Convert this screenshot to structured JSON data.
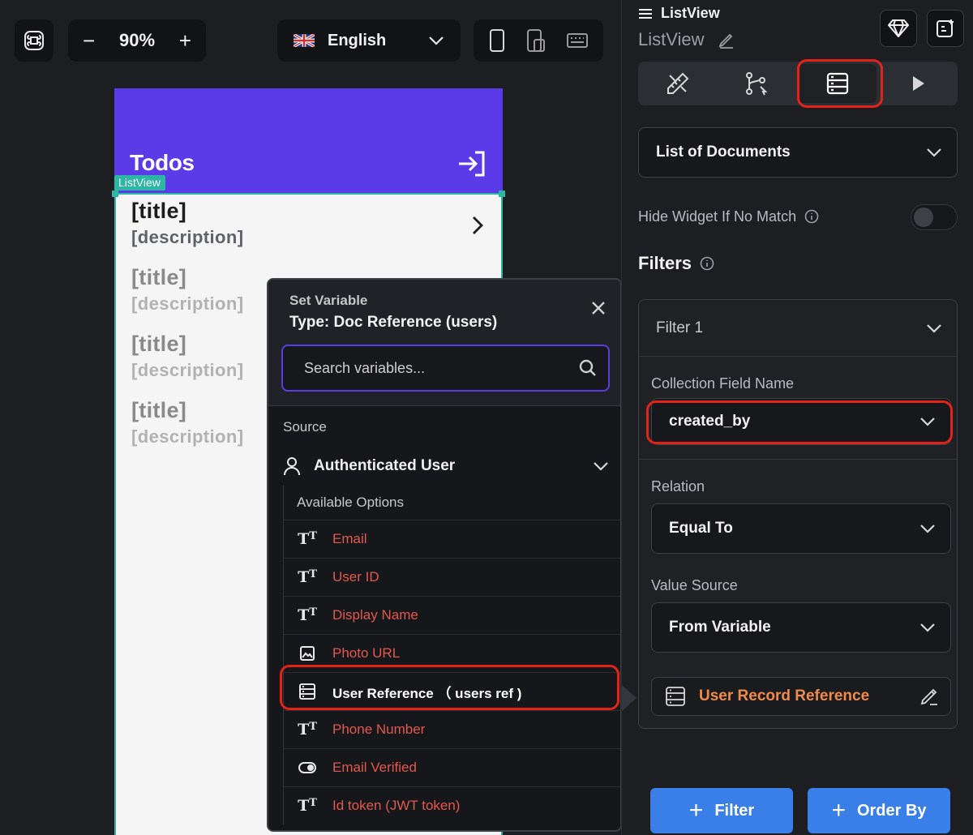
{
  "canvas": {
    "zoom": "90%",
    "zoom_minus": "−",
    "zoom_plus": "+",
    "language": "English",
    "phone": {
      "app_title": "Todos",
      "listview_tag": "ListView",
      "items": [
        {
          "title": "[title]",
          "description": "[description]"
        },
        {
          "title": "[title]",
          "description": "[description]"
        },
        {
          "title": "[title]",
          "description": "[description]"
        },
        {
          "title": "[title]",
          "description": "[description]"
        }
      ]
    }
  },
  "popup": {
    "subtitle": "Set Variable",
    "type": "Type: Doc Reference (users)",
    "search_placeholder": "Search variables...",
    "source_label": "Source",
    "source_value": "Authenticated User",
    "available_label": "Available Options",
    "options": [
      {
        "label": "Email",
        "icon": "text-type-icon"
      },
      {
        "label": "User ID",
        "icon": "text-type-icon"
      },
      {
        "label": "Display Name",
        "icon": "text-type-icon"
      },
      {
        "label": "Photo URL",
        "icon": "image-icon"
      },
      {
        "label": "User Reference （ users ref )",
        "icon": "database-icon"
      },
      {
        "label": "Phone Number",
        "icon": "text-type-icon"
      },
      {
        "label": "Email Verified",
        "icon": "toggle-icon"
      },
      {
        "label": "Id token (JWT token)",
        "icon": "text-type-icon"
      }
    ]
  },
  "panel": {
    "widget_type": "ListView",
    "widget_name": "ListView",
    "query_type": "List of Documents",
    "hide_widget_label": "Hide Widget If No Match",
    "filters_heading": "Filters",
    "filter": {
      "name": "Filter 1",
      "collection_field_label": "Collection Field Name",
      "collection_field_value": "created_by",
      "relation_label": "Relation",
      "relation_value": "Equal To",
      "value_source_label": "Value Source",
      "value_source_value": "From Variable",
      "variable_value": "User Record Reference"
    },
    "add_filter_label": "Filter",
    "order_by_label": "Order By"
  },
  "colors": {
    "accent": "#5b3be8",
    "highlight": "#e5221a",
    "option_text": "#e2584f",
    "variable_text": "#f08a4b",
    "button_blue": "#3a7ee8",
    "listview_teal": "#2bb7a4"
  }
}
